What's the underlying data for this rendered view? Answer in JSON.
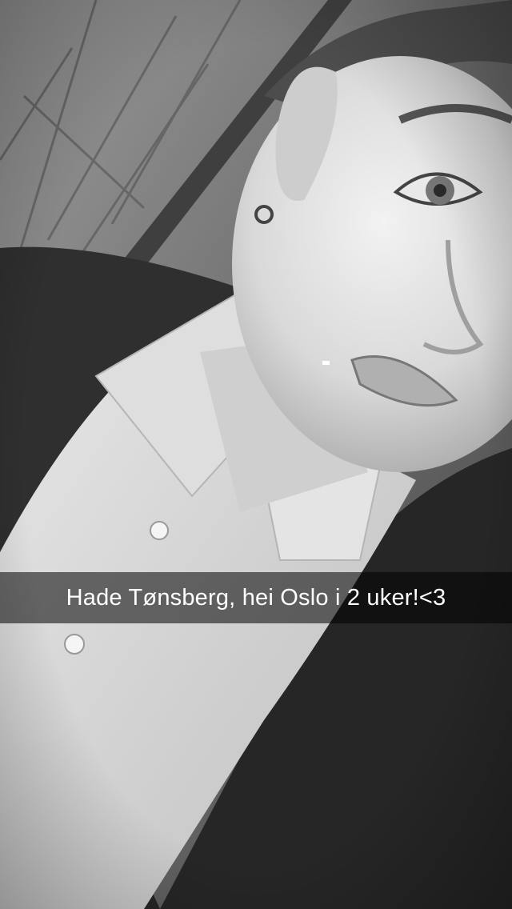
{
  "snap": {
    "caption": "Hade Tønsberg, hei Oslo i 2 uker!<3",
    "filter": "black-and-white",
    "caption_bar_color": "#000000"
  }
}
